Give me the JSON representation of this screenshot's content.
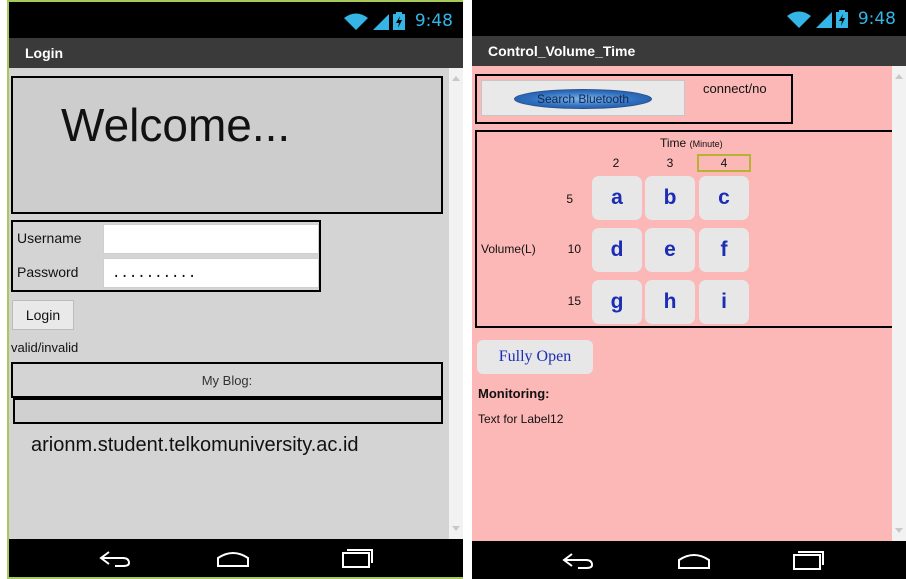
{
  "status_bar": {
    "time": "9:48",
    "icons": [
      "wifi-icon",
      "signal-icon",
      "battery-icon"
    ]
  },
  "left_screen": {
    "title": "Login",
    "welcome": "Welcome...",
    "username_label": "Username",
    "username_value": "",
    "password_label": "Password",
    "password_value": "..........",
    "login_button": "Login",
    "status_text": "valid/invalid",
    "blog_label": "My Blog:",
    "blog_field_value": "",
    "blog_url": "arionm.student.telkomuniversity.ac.id"
  },
  "right_screen": {
    "title": "Control_Volume_Time",
    "search_button": "Search Bluetooth",
    "connect_status": "connect/no",
    "time_label": "Time",
    "time_unit": "(Minute)",
    "columns": [
      "2",
      "3",
      "4"
    ],
    "selected_column": "4",
    "volume_label": "Volume(L)",
    "rows": [
      "5",
      "10",
      "15"
    ],
    "buttons": [
      "a",
      "b",
      "c",
      "d",
      "e",
      "f",
      "g",
      "h",
      "i"
    ],
    "fully_open_button": "Fully Open",
    "monitoring_label": "Monitoring:",
    "label12_text": "Text for Label12"
  },
  "colors": {
    "left_background": "#d4d4d4",
    "right_background": "#fcb8b6",
    "button_text": "#1b2db5",
    "status_accent": "#34b5e5",
    "title_bar": "#3a3a3a"
  },
  "nav_icons": [
    "back-icon",
    "home-icon",
    "recent-apps-icon"
  ]
}
